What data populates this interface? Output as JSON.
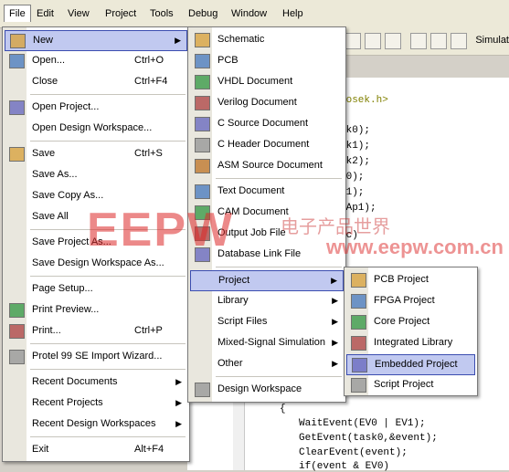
{
  "menubar": [
    "File",
    "Edit",
    "View",
    "Project",
    "Tools",
    "Debug",
    "Window",
    "Help"
  ],
  "toolbar": {
    "label": "Simulat"
  },
  "code": {
    "include": "/osek.h>",
    "lines": [
      "sk0);",
      "sk1);",
      "sk2);",
      "V0);",
      "V1);",
      "(Ap1);",
      "gc)",
      "{",
      "WaitEvent(EV0 | EV1);",
      "GetEvent(task0,&event);",
      "ClearEvent(event);",
      "if(event & EV0)"
    ]
  },
  "file_menu": [
    {
      "label": "New",
      "submenu": true,
      "icon": "new-icon"
    },
    {
      "label": "Open...",
      "accel": "Ctrl+O",
      "icon": "open-folder-icon"
    },
    {
      "label": "Close",
      "accel": "Ctrl+F4"
    },
    {
      "sep": true
    },
    {
      "label": "Open Project...",
      "icon": "open-project-icon"
    },
    {
      "label": "Open Design Workspace..."
    },
    {
      "sep": true
    },
    {
      "label": "Save",
      "accel": "Ctrl+S",
      "icon": "save-icon"
    },
    {
      "label": "Save As..."
    },
    {
      "label": "Save Copy As..."
    },
    {
      "label": "Save All"
    },
    {
      "sep": true
    },
    {
      "label": "Save Project As..."
    },
    {
      "label": "Save Design Workspace As..."
    },
    {
      "sep": true
    },
    {
      "label": "Page Setup..."
    },
    {
      "label": "Print Preview...",
      "icon": "print-preview-icon"
    },
    {
      "label": "Print...",
      "accel": "Ctrl+P",
      "icon": "print-icon"
    },
    {
      "sep": true
    },
    {
      "label": "Protel 99 SE Import Wizard...",
      "icon": "import-wizard-icon"
    },
    {
      "sep": true
    },
    {
      "label": "Recent Documents",
      "submenu": true
    },
    {
      "label": "Recent Projects",
      "submenu": true
    },
    {
      "label": "Recent Design Workspaces",
      "submenu": true
    },
    {
      "sep": true
    },
    {
      "label": "Exit",
      "accel": "Alt+F4"
    }
  ],
  "new_menu": [
    {
      "label": "Schematic",
      "icon": "schematic-icon"
    },
    {
      "label": "PCB",
      "icon": "pcb-icon"
    },
    {
      "label": "VHDL Document",
      "icon": "vhdl-icon"
    },
    {
      "label": "Verilog Document",
      "icon": "verilog-icon"
    },
    {
      "label": "C Source Document",
      "icon": "c-source-icon"
    },
    {
      "label": "C Header Document",
      "icon": "c-header-icon"
    },
    {
      "label": "ASM Source Document",
      "icon": "asm-icon"
    },
    {
      "sep": true
    },
    {
      "label": "Text Document",
      "icon": "text-doc-icon"
    },
    {
      "label": "CAM Document",
      "icon": "cam-icon"
    },
    {
      "label": "Output Job File",
      "icon": "output-job-icon"
    },
    {
      "label": "Database Link File",
      "icon": "db-link-icon"
    },
    {
      "sep": true
    },
    {
      "label": "Project",
      "submenu": true
    },
    {
      "label": "Library",
      "submenu": true
    },
    {
      "label": "Script Files",
      "submenu": true
    },
    {
      "label": "Mixed-Signal Simulation",
      "submenu": true
    },
    {
      "label": "Other",
      "submenu": true
    },
    {
      "sep": true
    },
    {
      "label": "Design Workspace",
      "icon": "workspace-icon"
    }
  ],
  "project_menu": [
    {
      "label": "PCB Project",
      "icon": "pcb-project-icon"
    },
    {
      "label": "FPGA Project",
      "icon": "fpga-project-icon"
    },
    {
      "label": "Core Project",
      "icon": "core-project-icon"
    },
    {
      "label": "Integrated Library",
      "icon": "integrated-library-icon"
    },
    {
      "label": "Embedded Project",
      "icon": "embedded-project-icon"
    },
    {
      "label": "Script Project",
      "icon": "script-project-icon"
    }
  ],
  "watermark": {
    "big": "EEPW",
    "cn": "电子产品世界",
    "url": "www.eepw.com.cn"
  }
}
